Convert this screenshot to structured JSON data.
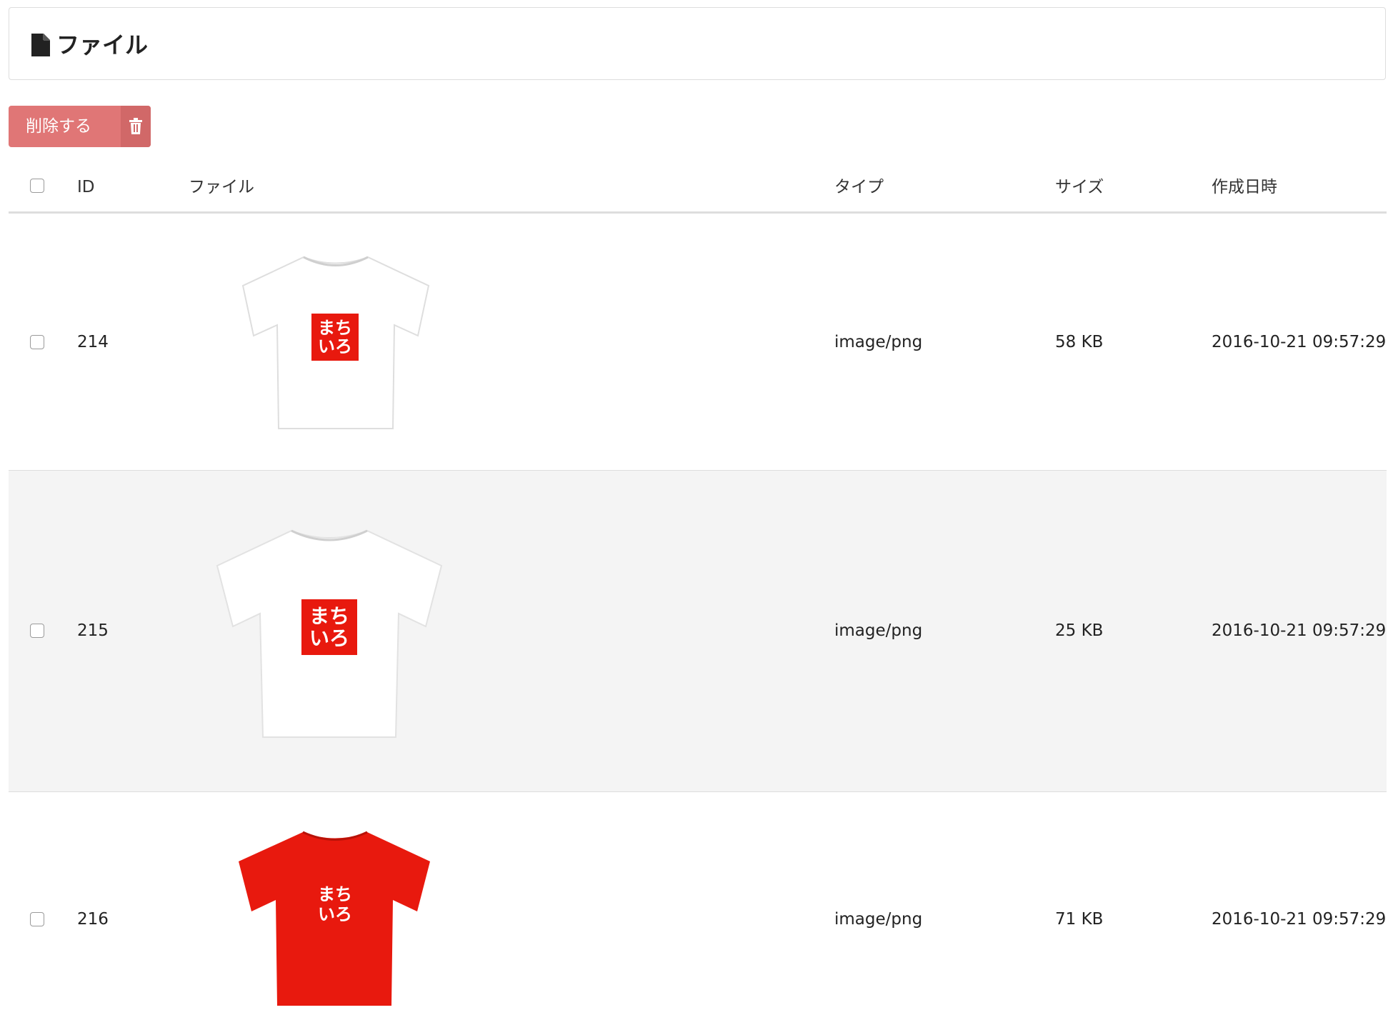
{
  "header": {
    "title": "ファイル",
    "icon": "file-icon"
  },
  "toolbar": {
    "delete_label": "削除する",
    "delete_icon": "trash-icon",
    "delete_color": "#e07676"
  },
  "table": {
    "columns": {
      "id": "ID",
      "file": "ファイル",
      "type": "タイプ",
      "size": "サイズ",
      "created": "作成日時"
    },
    "rows": [
      {
        "id": "214",
        "type": "image/png",
        "size": "58 KB",
        "created": "2016-10-21 09:57:29",
        "shirt_color": "#ffffff",
        "logo_text": [
          "まち",
          "いろ"
        ]
      },
      {
        "id": "215",
        "type": "image/png",
        "size": "25 KB",
        "created": "2016-10-21 09:57:29",
        "shirt_color": "#ffffff",
        "logo_text": [
          "まち",
          "いろ"
        ]
      },
      {
        "id": "216",
        "type": "image/png",
        "size": "71 KB",
        "created": "2016-10-21 09:57:29",
        "shirt_color": "#e8190e",
        "logo_text": [
          "まち",
          "いろ"
        ]
      }
    ]
  },
  "colors": {
    "logo_red": "#e8190e",
    "border": "#dddddd",
    "alt_row": "#f4f4f4"
  }
}
